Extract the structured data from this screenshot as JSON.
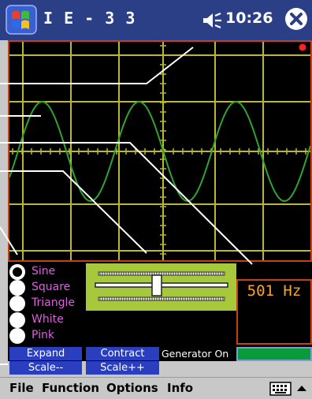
{
  "titlebar": {
    "app_title": "I E - 3 3",
    "time": "10:26",
    "icons": [
      "windows-flag-icon",
      "speaker-icon",
      "close-icon"
    ]
  },
  "scope": {
    "frequency_display": "501 Hz",
    "indicator": "red-dot",
    "waveform": "sine",
    "trace_color": "#2fa52f",
    "grid_color": "#b9b92a",
    "frame_color": "#c84010"
  },
  "waveform_options": [
    {
      "label": "Sine",
      "selected": true
    },
    {
      "label": "Square",
      "selected": false
    },
    {
      "label": "Triangle",
      "selected": false
    },
    {
      "label": "White",
      "selected": false
    },
    {
      "label": "Pink",
      "selected": false
    }
  ],
  "slider": {
    "position": 0.5
  },
  "buttons": {
    "expand": "Expand",
    "contract": "Contract",
    "scale_down": "Scale--",
    "scale_up": "Scale++"
  },
  "generator": {
    "label": "Generator On",
    "indicator_color": "#0a9a3e"
  },
  "menu": {
    "file": "File",
    "function": "Function",
    "options": "Options",
    "info": "Info"
  },
  "colors": {
    "title_bar": "#2b3f86",
    "button_blue": "#2a3fc0",
    "slider_panel": "#a6c83a",
    "option_text": "#e05fe0",
    "frequency_text": "#ffa321"
  }
}
